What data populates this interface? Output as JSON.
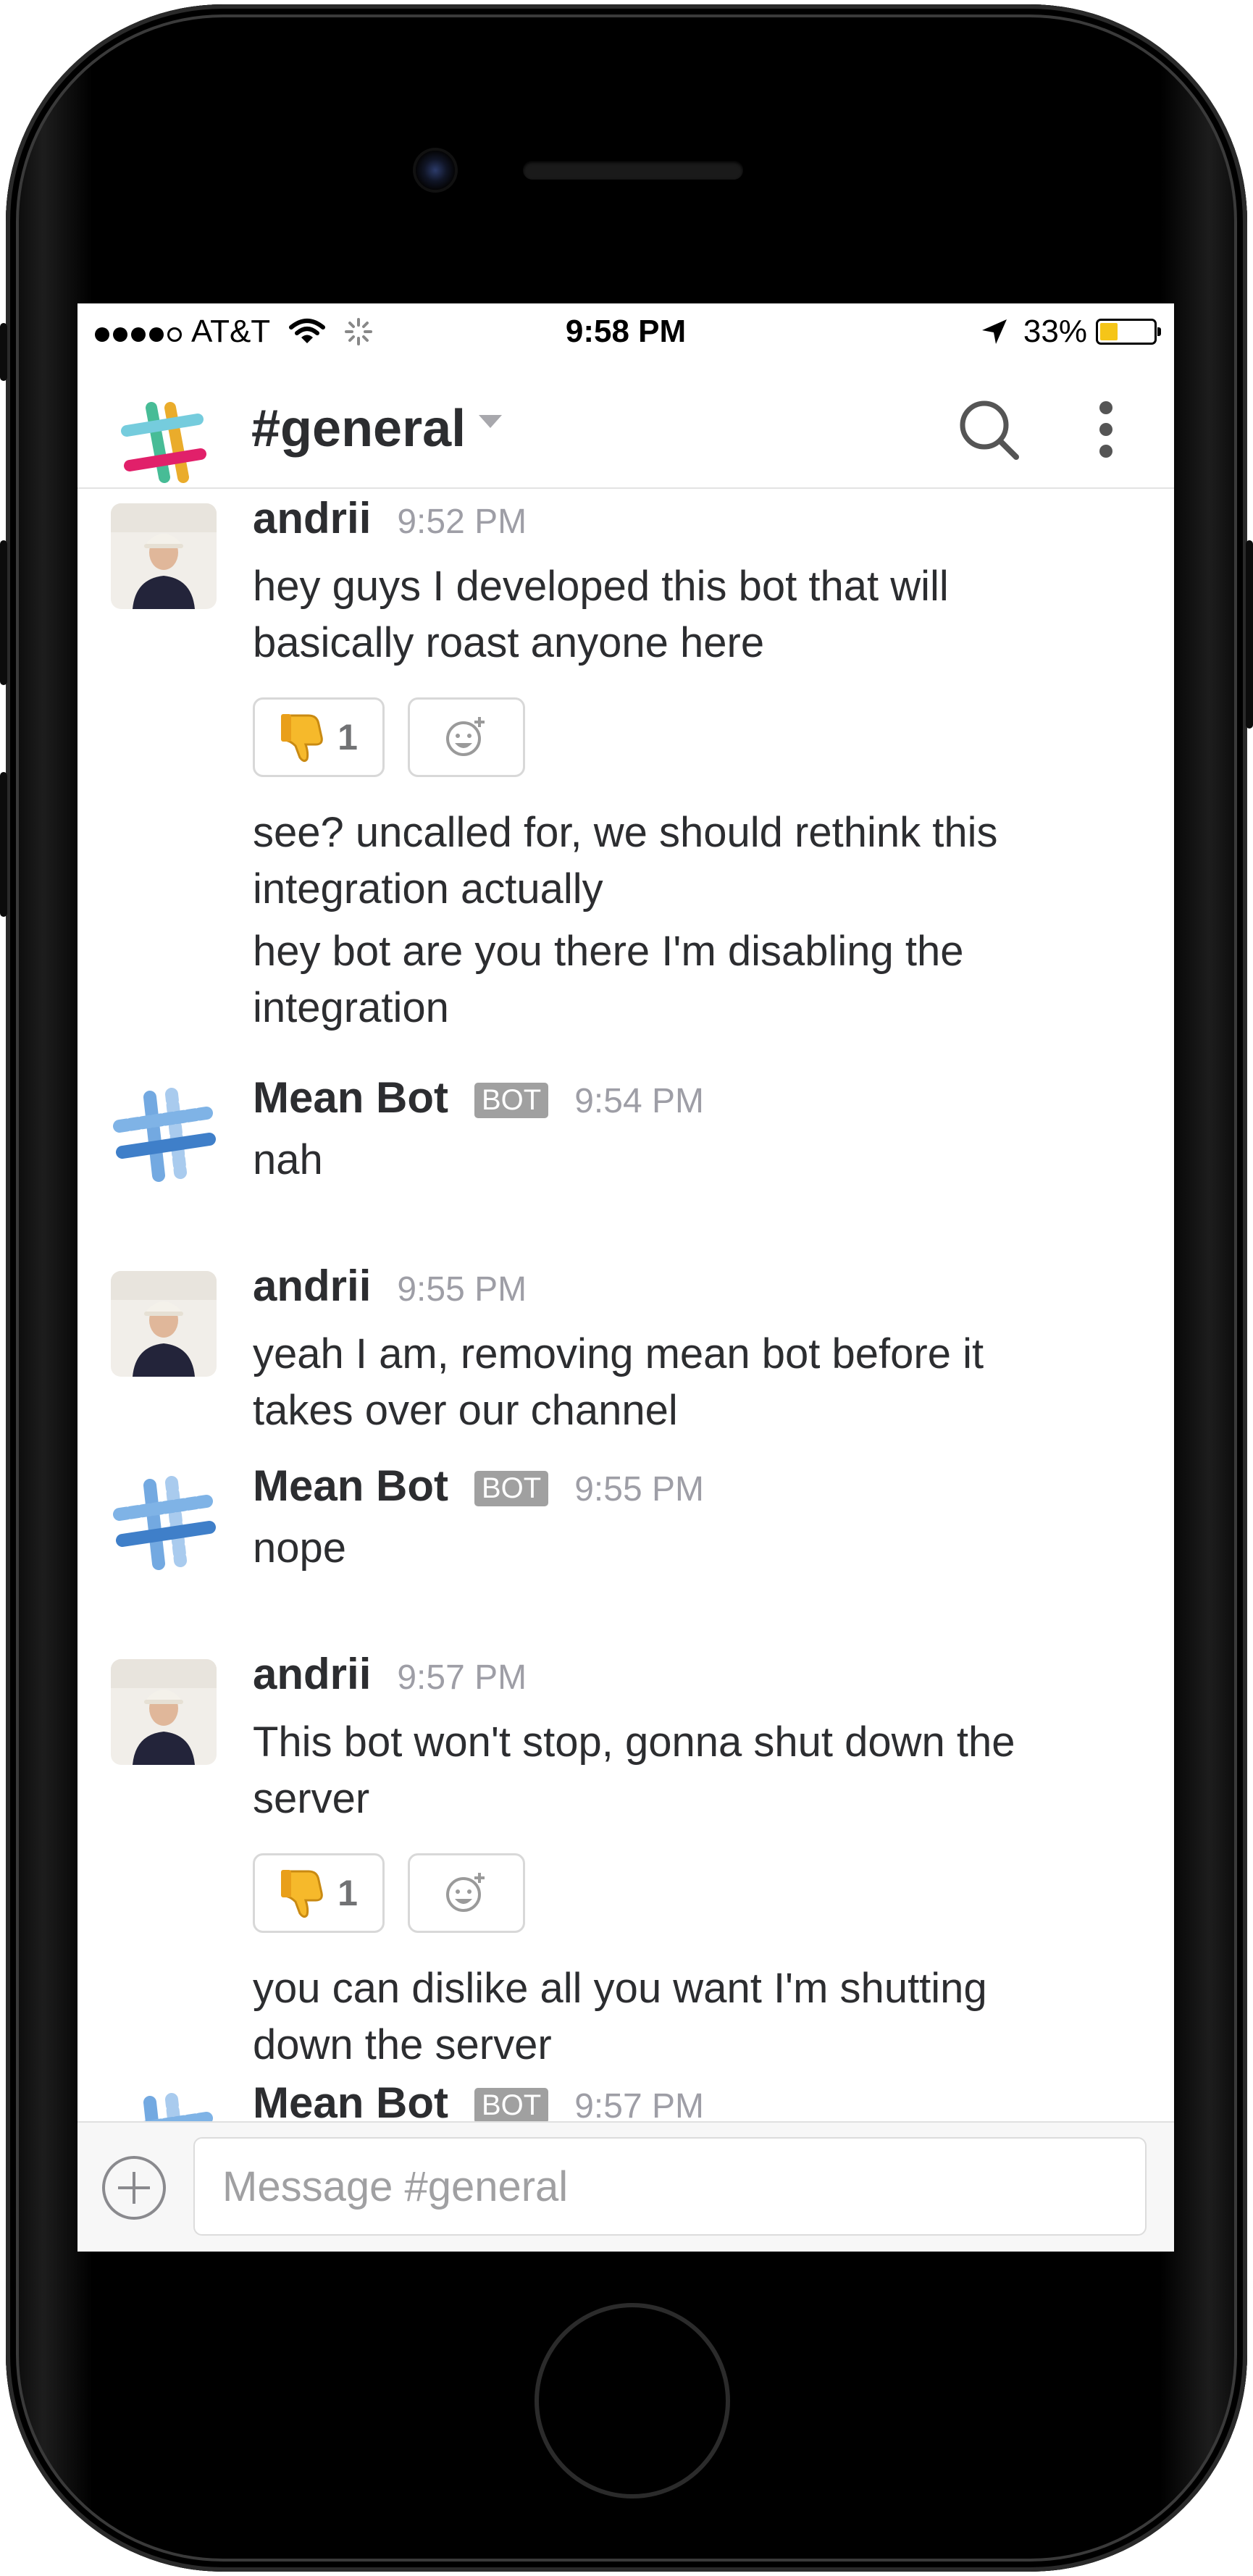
{
  "status_bar": {
    "carrier": "AT&T",
    "time": "9:58 PM",
    "battery": "33%",
    "battery_level": 0.33,
    "signal_bars": 4,
    "signal_max": 5
  },
  "header": {
    "channel": "#general",
    "icons": [
      "slack-logo",
      "chevron-down-icon",
      "search-icon",
      "more-vertical-icon"
    ]
  },
  "messages": [
    {
      "author": "andrii",
      "time": "9:52 PM",
      "lines": [
        "hey guys I developed this bot that will basically roast anyone here"
      ],
      "reaction": {
        "emoji": "thumbs-down",
        "count": "1"
      },
      "more_lines": [
        "see? uncalled for, we should rethink this integration actually",
        "hey bot are you there I'm disabling the integration"
      ]
    },
    {
      "author": "Mean Bot",
      "badge": "BOT",
      "time": "9:54 PM",
      "lines": [
        "nah"
      ]
    },
    {
      "author": "andrii",
      "time": "9:55 PM",
      "lines": [
        "yeah I am, removing mean bot before it takes over our channel"
      ]
    },
    {
      "author": "Mean Bot",
      "badge": "BOT",
      "time": "9:55 PM",
      "lines": [
        "nope"
      ]
    },
    {
      "author": "andrii",
      "time": "9:57 PM",
      "lines": [
        "This bot won't stop, gonna shut down the server"
      ],
      "reaction": {
        "emoji": "thumbs-down",
        "count": "1"
      },
      "more_lines": [
        "you can dislike all you want I'm shutting down the server"
      ]
    },
    {
      "author": "Mean Bot",
      "badge": "BOT",
      "time": "9:57 PM",
      "lines": []
    }
  ],
  "composer": {
    "placeholder": "Message #general",
    "value": ""
  },
  "colors": {
    "text": "#2c2d30",
    "timestamp": "#9e9ea6",
    "bot_badge": "#a0a0a0",
    "battery": "#f5c518",
    "bot_avatar_blue": "#3f7fc9"
  }
}
